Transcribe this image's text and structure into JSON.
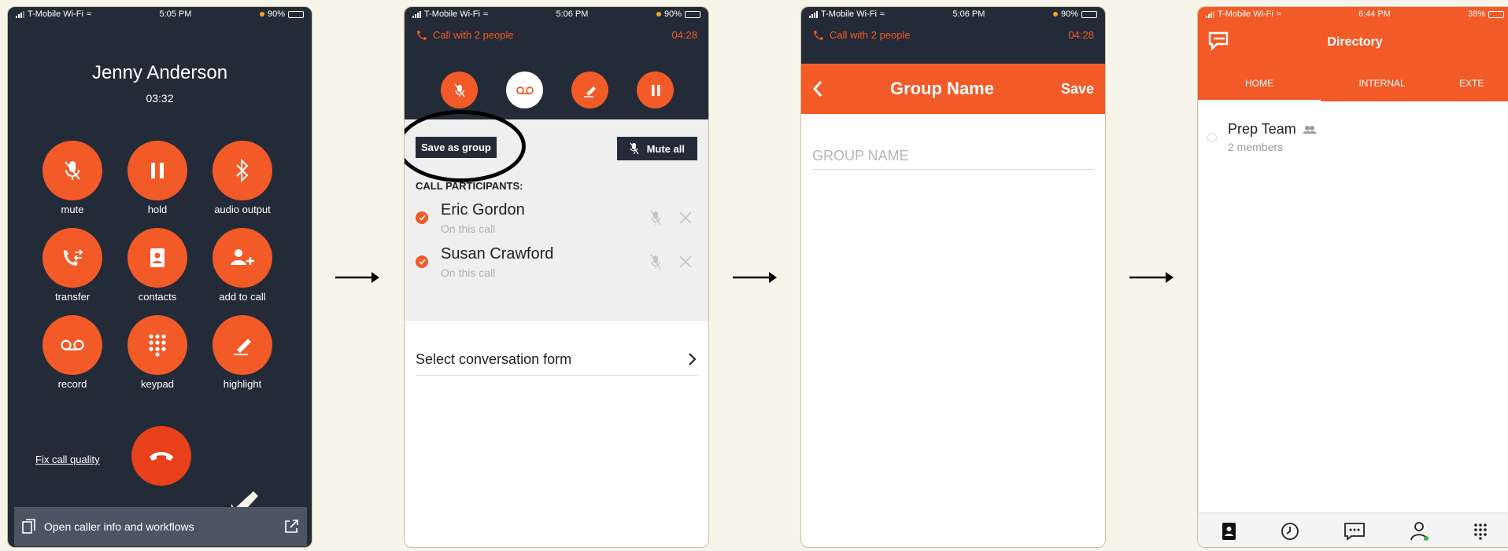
{
  "phone1": {
    "status": {
      "carrier": "T-Mobile Wi-Fi",
      "time": "5:05 PM",
      "battery": "90%"
    },
    "caller_name": "Jenny Anderson",
    "call_timer": "03:32",
    "buttons": [
      {
        "label": "mute",
        "icon": "mic-off-icon"
      },
      {
        "label": "hold",
        "icon": "pause-icon"
      },
      {
        "label": "audio output",
        "icon": "bluetooth-icon"
      },
      {
        "label": "transfer",
        "icon": "transfer-icon"
      },
      {
        "label": "contacts",
        "icon": "contacts-icon"
      },
      {
        "label": "add to call",
        "icon": "add-user-icon"
      },
      {
        "label": "record",
        "icon": "voicemail-icon"
      },
      {
        "label": "keypad",
        "icon": "keypad-icon"
      },
      {
        "label": "highlight",
        "icon": "pen-icon"
      }
    ],
    "fix_quality": "Fix call quality",
    "footer_text": "Open caller info and workflows"
  },
  "phone2": {
    "status": {
      "carrier": "T-Mobile Wi-Fi",
      "time": "5:06 PM",
      "battery": "90%"
    },
    "call_with": "Call with 2 people",
    "timer": "04:28",
    "save_as_group": "Save as group",
    "mute_all": "Mute all",
    "participants_header": "CALL PARTICIPANTS:",
    "participants": [
      {
        "name": "Eric Gordon",
        "status": "On this call"
      },
      {
        "name": "Susan Crawford",
        "status": "On this call"
      }
    ],
    "select_form": "Select conversation form"
  },
  "phone3": {
    "status": {
      "carrier": "T-Mobile Wi-Fi",
      "time": "5:06 PM",
      "battery": "90%"
    },
    "call_with": "Call with 2 people",
    "timer": "04:28",
    "title": "Group Name",
    "save": "Save",
    "placeholder": "GROUP NAME"
  },
  "phone4": {
    "status": {
      "carrier": "T-Mobile Wi-Fi",
      "time": "6:44 PM",
      "battery": "38%"
    },
    "title": "Directory",
    "tabs": [
      "HOME",
      "INTERNAL",
      "EXTE"
    ],
    "group": {
      "name": "Prep Team",
      "members": "2 members"
    }
  },
  "colors": {
    "accent": "#f25a28",
    "navy": "#242b38",
    "background": "#f7f4ea"
  }
}
